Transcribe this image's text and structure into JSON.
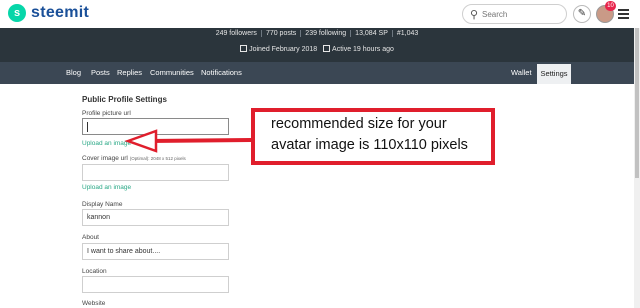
{
  "header": {
    "brand": "steemit",
    "logo_letter": "s",
    "search_placeholder": "Search",
    "notification_count": "10"
  },
  "profile": {
    "stats": [
      "249 followers",
      "770 posts",
      "239 following",
      "13,084 SP",
      "#1,043"
    ],
    "joined": "Joined February 2018",
    "active": "Active 19 hours ago"
  },
  "nav": {
    "left_items": [
      "Blog",
      "Posts",
      "Replies",
      "Communities",
      "Notifications"
    ],
    "wallet": "Wallet",
    "settings": "Settings"
  },
  "form": {
    "title": "Public Profile Settings",
    "profile_picture_label": "Profile picture url",
    "profile_picture_value": "",
    "upload_label": "Upload an image",
    "cover_label": "Cover image url",
    "cover_hint": "(Optimal): 2048 x 512 pixels",
    "cover_value": "",
    "cover_upload_label": "Upload an image",
    "display_name_label": "Display Name",
    "display_name_value": "kannon",
    "about_label": "About",
    "about_value": "I want to share about....",
    "location_label": "Location",
    "location_value": "",
    "website_label": "Website"
  },
  "annotation": {
    "line1": "recommended size for your",
    "line2": "avatar image is 110x110 pixels"
  },
  "colors": {
    "brand_green": "#06d6a9",
    "brand_blue": "#1a5099",
    "profile_band": "#2b353c",
    "nav_bar": "#3b4754",
    "link_green": "#2aa886",
    "annotation_red": "#e01e2c"
  }
}
